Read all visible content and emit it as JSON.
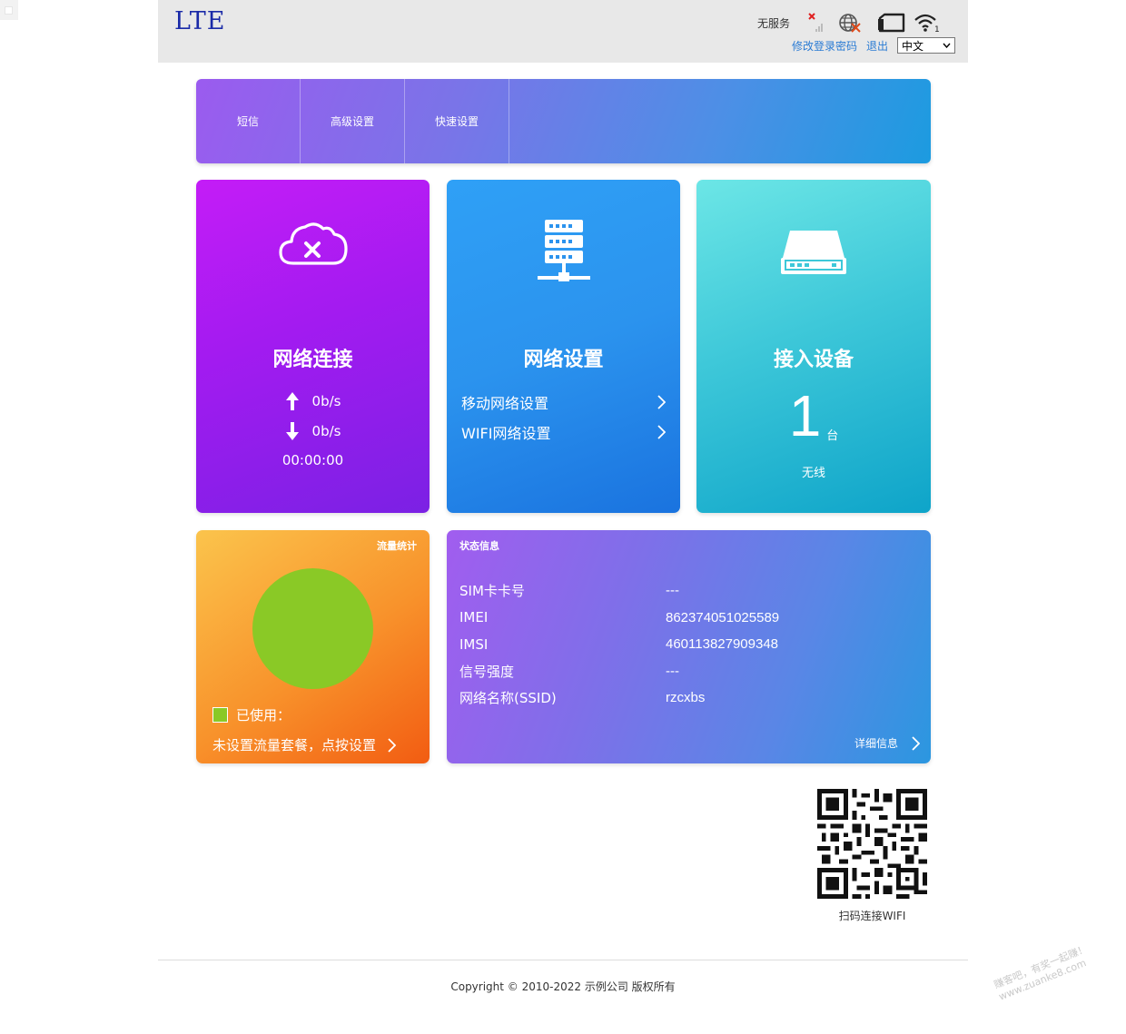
{
  "header": {
    "logo": "LTE",
    "service_status": "无服务",
    "change_password": "修改登录密码",
    "logout": "退出",
    "language": "中文"
  },
  "nav": {
    "items": [
      {
        "label": "短信"
      },
      {
        "label": "高级设置"
      },
      {
        "label": "快速设置"
      }
    ]
  },
  "network_card": {
    "title": "网络连接",
    "upload_speed": "0b/s",
    "download_speed": "0b/s",
    "duration": "00:00:00",
    "icon": "cloud-disconnected-icon"
  },
  "settings_card": {
    "title": "网络设置",
    "mobile_link": "移动网络设置",
    "wifi_link": "WIFI网络设置",
    "icon": "server-icon"
  },
  "devices_card": {
    "title": "接入设备",
    "count": "1",
    "unit": "台",
    "type": "无线",
    "icon": "router-icon"
  },
  "traffic_card": {
    "title": "流量统计",
    "used_label": "已使用：",
    "plan_link": "未设置流量套餐，点按设置",
    "used_color": "#8ac926"
  },
  "status_card": {
    "title": "状态信息",
    "rows": [
      {
        "key": "SIM卡卡号",
        "value": "---"
      },
      {
        "key": "IMEI",
        "value": "862374051025589"
      },
      {
        "key": "IMSI",
        "value": "460113827909348"
      },
      {
        "key": "信号强度",
        "value": "---"
      },
      {
        "key": "网络名称(SSID)",
        "value": "rzcxbs"
      }
    ],
    "detail_link": "详细信息"
  },
  "qr": {
    "caption": "扫码连接WIFI"
  },
  "footer": {
    "copyright": "Copyright © 2010-2022 示例公司 版权所有"
  },
  "watermark": {
    "line1": "赚客吧，有奖一起赚！",
    "line2": "www.zuanke8.com"
  }
}
